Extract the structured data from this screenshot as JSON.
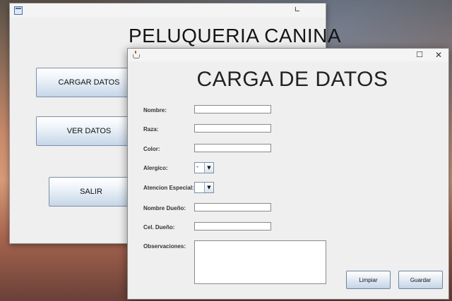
{
  "main_window": {
    "title": "PELUQUERIA CANINA",
    "minimize_glyph": "∟",
    "buttons": {
      "cargar": "CARGAR DATOS",
      "ver": "VER DATOS",
      "salir": "SALIR"
    }
  },
  "dialog": {
    "title": "CARGA DE DATOS",
    "maximize_glyph": "☐",
    "close_glyph": "✕",
    "fields": {
      "nombre_label": "Nombre:",
      "raza_label": "Raza:",
      "color_label": "Color:",
      "alergico_label": "Alergico:",
      "atencion_label": "Atencion Especial:",
      "nombre_duenio_label": "Nombre Dueño:",
      "cel_duenio_label": "Cel. Dueño:",
      "observaciones_label": "Observaciones:"
    },
    "alergico_value": "-",
    "atencion_value": "",
    "combo_arrow": "▼",
    "buttons": {
      "limpiar": "Limpiar",
      "guardar": "Guardar"
    }
  },
  "icons": [
    "app-window-icon",
    "java-icon",
    "minimize-icon",
    "maximize-icon",
    "close-icon",
    "dropdown-arrow-icon"
  ]
}
